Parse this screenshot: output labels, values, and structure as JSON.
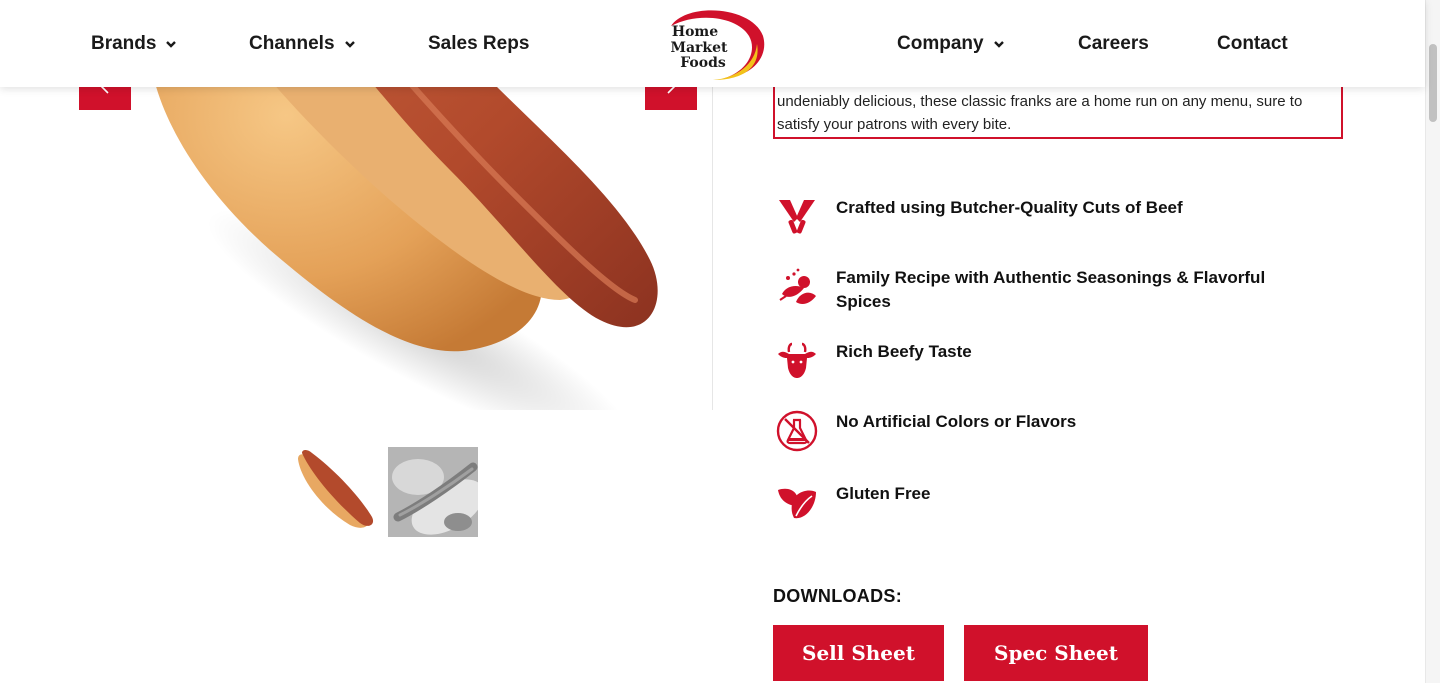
{
  "nav": {
    "left": [
      {
        "label": "Brands",
        "has_dropdown": true
      },
      {
        "label": "Channels",
        "has_dropdown": true
      },
      {
        "label": "Sales Reps",
        "has_dropdown": false
      }
    ],
    "right": [
      {
        "label": "Company",
        "has_dropdown": true
      },
      {
        "label": "Careers",
        "has_dropdown": false
      },
      {
        "label": "Contact",
        "has_dropdown": false
      }
    ],
    "logo": {
      "lines": [
        "Home",
        "Market",
        "Foods"
      ]
    }
  },
  "product": {
    "description": "undeniably delicious, these classic franks are a home run on any menu, sure to satisfy your patrons with every bite.",
    "features": [
      {
        "icon": "cleaver-icon",
        "text": "Crafted using Butcher-Quality Cuts of Beef"
      },
      {
        "icon": "spices-icon",
        "text": "Family Recipe with Authentic Seasonings & Flavorful Spices"
      },
      {
        "icon": "cow-icon",
        "text": "Rich Beefy Taste"
      },
      {
        "icon": "no-artificial-icon",
        "text": "No Artificial Colors or Flavors"
      },
      {
        "icon": "leaf-icon",
        "text": "Gluten Free"
      }
    ]
  },
  "downloads": {
    "title": "DOWNLOADS:",
    "sell_sheet": "Sell Sheet",
    "spec_sheet": "Spec Sheet"
  },
  "colors": {
    "brand_red": "#d0112b",
    "logo_yellow": "#f2c21a"
  }
}
